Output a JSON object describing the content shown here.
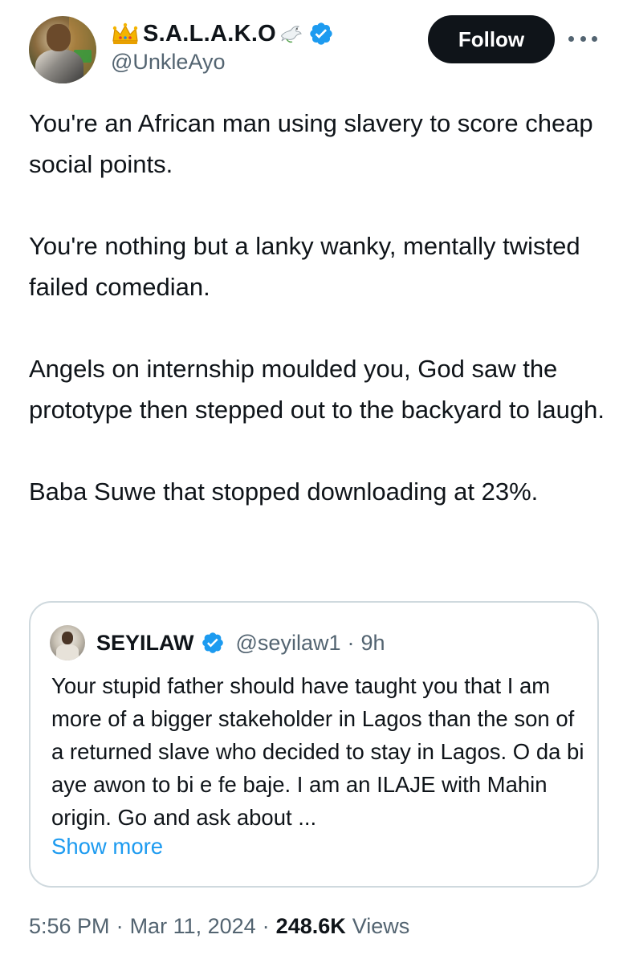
{
  "author": {
    "display_name": "S.A.L.A.K.O",
    "handle": "@UnkleAyo",
    "crown_icon": "crown-icon",
    "dove_icon": "dove-icon",
    "verified_icon": "verified-badge-icon",
    "verified_color": "#1d9bf0"
  },
  "actions": {
    "follow_label": "Follow",
    "more_icon": "more-horizontal-icon"
  },
  "tweet": {
    "paragraphs": [
      "You're an African man using slavery to score cheap social points.",
      "You're nothing but a lanky wanky, mentally twisted failed comedian.",
      "Angels on internship moulded you, God saw the prototype then stepped out to the backyard to laugh.",
      "Baba Suwe that stopped downloading at 23%."
    ]
  },
  "quote": {
    "name": "SEYILAW",
    "handle": "@seyilaw1",
    "dot": "·",
    "time": "9h",
    "text": "Your stupid father should have taught you that I am more of a bigger stakeholder in Lagos than the son of a returned slave who decided to stay in Lagos. O da bi aye awon to bi e fe baje. I am an ILAJE with Mahin origin. Go and ask about ...",
    "show_more": "Show more"
  },
  "meta": {
    "time": "5:56 PM",
    "date": "Mar 11, 2024",
    "views_count": "248.6K",
    "views_label": "Views",
    "sep": "·"
  },
  "colors": {
    "text": "#0f1419",
    "secondary": "#536471",
    "link": "#1d9bf0",
    "border": "#cfd9de",
    "button_bg": "#0f1419"
  }
}
